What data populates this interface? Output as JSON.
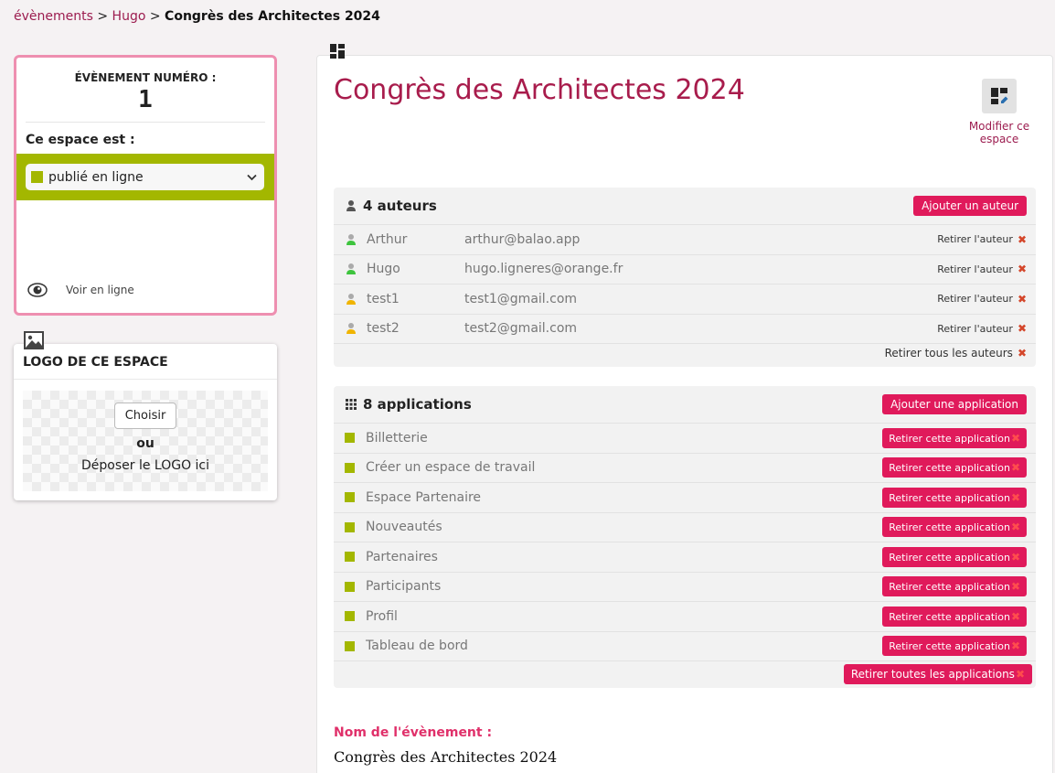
{
  "breadcrumb": {
    "item1": "évènements",
    "sep": ">",
    "item2": "Hugo",
    "current": "Congrès des Architectes 2024"
  },
  "event_card": {
    "number_label": "ÉVÈNEMENT NUMÉRO :",
    "number": "1",
    "state_label": "Ce espace est :",
    "state_value": "publié en ligne",
    "view_online": "Voir en ligne"
  },
  "logo_card": {
    "title": "LOGO DE CE ESPACE",
    "choose_button": "Choisir",
    "or": "ou",
    "drop_text": "Déposer le LOGO ici"
  },
  "main": {
    "title": "Congrès des Architectes 2024",
    "modify_label": "Modifier ce espace"
  },
  "authors": {
    "heading": "4 auteurs",
    "add_button": "Ajouter un auteur",
    "remove_label": "Retirer l'auteur",
    "remove_all": "Retirer tous les auteurs",
    "items": [
      {
        "name": "Arthur",
        "email": "arthur@balao.app",
        "status_color": "#3ec43e"
      },
      {
        "name": "Hugo",
        "email": "hugo.ligneres@orange.fr",
        "status_color": "#3ec43e"
      },
      {
        "name": "test1",
        "email": "test1@gmail.com",
        "status_color": "#f0b400"
      },
      {
        "name": "test2",
        "email": "test2@gmail.com",
        "status_color": "#f0b400"
      }
    ]
  },
  "applications": {
    "heading": "8 applications",
    "add_button": "Ajouter une application",
    "remove_label": "Retirer cette application",
    "remove_all": "Retirer toutes les applications",
    "items": [
      "Billetterie",
      "Créer un espace de travail",
      "Espace Partenaire",
      "Nouveautés",
      "Partenaires",
      "Participants",
      "Profil",
      "Tableau de bord"
    ]
  },
  "field": {
    "label": "Nom de l'évènement :",
    "value": "Congrès des Architectes 2024"
  },
  "colors": {
    "accent": "#a81c4c",
    "button": "#e01a5b",
    "published": "#a3b700",
    "card_border": "#ee8fb0"
  }
}
